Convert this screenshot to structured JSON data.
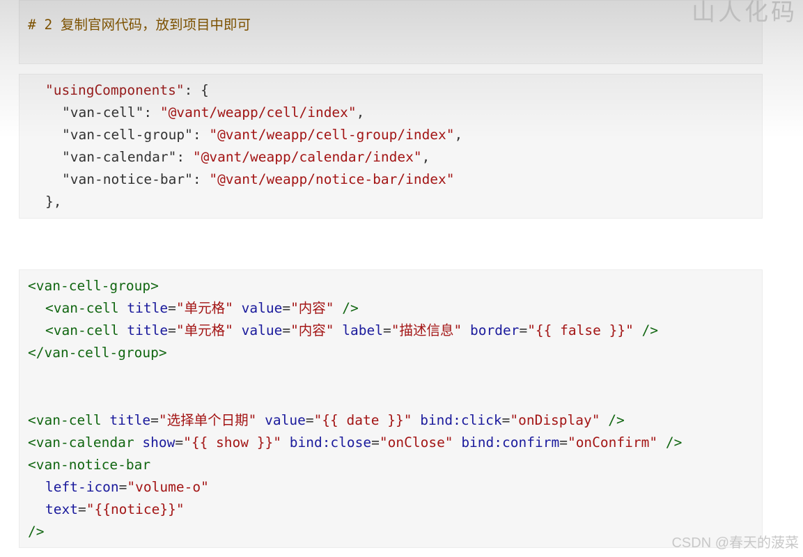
{
  "header_fragment": "山人化码",
  "comment_block": {
    "text": "# 2 复制官网代码，放到项目中即可"
  },
  "json_block": {
    "line1": {
      "key": "\"usingComponents\"",
      "rest": ": {"
    },
    "line2": {
      "key": "\"van-cell\"",
      "sep": ": ",
      "value": "\"@vant/weapp/cell/index\"",
      "end": ","
    },
    "line3": {
      "key": "\"van-cell-group\"",
      "sep": ": ",
      "value": "\"@vant/weapp/cell-group/index\"",
      "end": ","
    },
    "line4": {
      "key": "\"van-calendar\"",
      "sep": ": ",
      "value": "\"@vant/weapp/calendar/index\"",
      "end": ","
    },
    "line5": {
      "key": "\"van-notice-bar\"",
      "sep": ": ",
      "value": "\"@vant/weapp/notice-bar/index\""
    },
    "line6": {
      "text": "},"
    }
  },
  "wxml_block": {
    "l1": {
      "tag": "<van-cell-group>"
    },
    "l2": {
      "tag": "<van-cell",
      "a1": "title",
      "v1": "\"单元格\"",
      "a2": "value",
      "v2": "\"内容\"",
      "close": "/>"
    },
    "l3": {
      "tag": "<van-cell",
      "a1": "title",
      "v1": "\"单元格\"",
      "a2": "value",
      "v2": "\"内容\"",
      "a3": "label",
      "v3": "\"描述信息\"",
      "a4": "border",
      "v4": "\"{{ false }}\"",
      "close": "/>"
    },
    "l4": {
      "tag": "</van-cell-group>"
    },
    "l5": {
      "tag": "<van-cell",
      "a1": "title",
      "v1": "\"选择单个日期\"",
      "a2": "value",
      "v2": "\"{{ date }}\"",
      "a3": "bind:click",
      "v3": "\"onDisplay\"",
      "close": "/>"
    },
    "l6": {
      "tag": "<van-calendar",
      "a1": "show",
      "v1": "\"{{ show }}\"",
      "a2": "bind:close",
      "v2": "\"onClose\"",
      "a3": "bind:confirm",
      "v3": "\"onConfirm\"",
      "close": "/>"
    },
    "l7": {
      "tag": "<van-notice-bar"
    },
    "l8": {
      "a1": "left-icon",
      "v1": "\"volume-o\""
    },
    "l9": {
      "a1": "text",
      "v1": "\"{{notice}}\""
    },
    "l10": {
      "tag": "/>"
    }
  },
  "watermark": "CSDN @春天的菠菜"
}
